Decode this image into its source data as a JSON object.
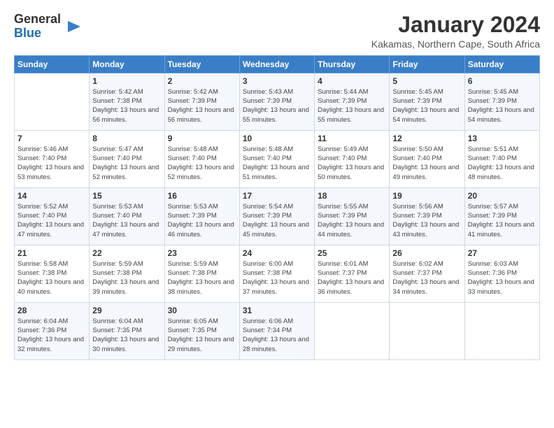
{
  "logo": {
    "text_general": "General",
    "text_blue": "Blue"
  },
  "title": "January 2024",
  "subtitle": "Kakamas, Northern Cape, South Africa",
  "headers": [
    "Sunday",
    "Monday",
    "Tuesday",
    "Wednesday",
    "Thursday",
    "Friday",
    "Saturday"
  ],
  "weeks": [
    [
      {
        "num": "",
        "sunrise": "",
        "sunset": "",
        "daylight": ""
      },
      {
        "num": "1",
        "sunrise": "Sunrise: 5:42 AM",
        "sunset": "Sunset: 7:38 PM",
        "daylight": "Daylight: 13 hours and 56 minutes."
      },
      {
        "num": "2",
        "sunrise": "Sunrise: 5:42 AM",
        "sunset": "Sunset: 7:39 PM",
        "daylight": "Daylight: 13 hours and 56 minutes."
      },
      {
        "num": "3",
        "sunrise": "Sunrise: 5:43 AM",
        "sunset": "Sunset: 7:39 PM",
        "daylight": "Daylight: 13 hours and 55 minutes."
      },
      {
        "num": "4",
        "sunrise": "Sunrise: 5:44 AM",
        "sunset": "Sunset: 7:39 PM",
        "daylight": "Daylight: 13 hours and 55 minutes."
      },
      {
        "num": "5",
        "sunrise": "Sunrise: 5:45 AM",
        "sunset": "Sunset: 7:39 PM",
        "daylight": "Daylight: 13 hours and 54 minutes."
      },
      {
        "num": "6",
        "sunrise": "Sunrise: 5:45 AM",
        "sunset": "Sunset: 7:39 PM",
        "daylight": "Daylight: 13 hours and 54 minutes."
      }
    ],
    [
      {
        "num": "7",
        "sunrise": "Sunrise: 5:46 AM",
        "sunset": "Sunset: 7:40 PM",
        "daylight": "Daylight: 13 hours and 53 minutes."
      },
      {
        "num": "8",
        "sunrise": "Sunrise: 5:47 AM",
        "sunset": "Sunset: 7:40 PM",
        "daylight": "Daylight: 13 hours and 52 minutes."
      },
      {
        "num": "9",
        "sunrise": "Sunrise: 5:48 AM",
        "sunset": "Sunset: 7:40 PM",
        "daylight": "Daylight: 13 hours and 52 minutes."
      },
      {
        "num": "10",
        "sunrise": "Sunrise: 5:48 AM",
        "sunset": "Sunset: 7:40 PM",
        "daylight": "Daylight: 13 hours and 51 minutes."
      },
      {
        "num": "11",
        "sunrise": "Sunrise: 5:49 AM",
        "sunset": "Sunset: 7:40 PM",
        "daylight": "Daylight: 13 hours and 50 minutes."
      },
      {
        "num": "12",
        "sunrise": "Sunrise: 5:50 AM",
        "sunset": "Sunset: 7:40 PM",
        "daylight": "Daylight: 13 hours and 49 minutes."
      },
      {
        "num": "13",
        "sunrise": "Sunrise: 5:51 AM",
        "sunset": "Sunset: 7:40 PM",
        "daylight": "Daylight: 13 hours and 48 minutes."
      }
    ],
    [
      {
        "num": "14",
        "sunrise": "Sunrise: 5:52 AM",
        "sunset": "Sunset: 7:40 PM",
        "daylight": "Daylight: 13 hours and 47 minutes."
      },
      {
        "num": "15",
        "sunrise": "Sunrise: 5:53 AM",
        "sunset": "Sunset: 7:40 PM",
        "daylight": "Daylight: 13 hours and 47 minutes."
      },
      {
        "num": "16",
        "sunrise": "Sunrise: 5:53 AM",
        "sunset": "Sunset: 7:39 PM",
        "daylight": "Daylight: 13 hours and 46 minutes."
      },
      {
        "num": "17",
        "sunrise": "Sunrise: 5:54 AM",
        "sunset": "Sunset: 7:39 PM",
        "daylight": "Daylight: 13 hours and 45 minutes."
      },
      {
        "num": "18",
        "sunrise": "Sunrise: 5:55 AM",
        "sunset": "Sunset: 7:39 PM",
        "daylight": "Daylight: 13 hours and 44 minutes."
      },
      {
        "num": "19",
        "sunrise": "Sunrise: 5:56 AM",
        "sunset": "Sunset: 7:39 PM",
        "daylight": "Daylight: 13 hours and 43 minutes."
      },
      {
        "num": "20",
        "sunrise": "Sunrise: 5:57 AM",
        "sunset": "Sunset: 7:39 PM",
        "daylight": "Daylight: 13 hours and 41 minutes."
      }
    ],
    [
      {
        "num": "21",
        "sunrise": "Sunrise: 5:58 AM",
        "sunset": "Sunset: 7:38 PM",
        "daylight": "Daylight: 13 hours and 40 minutes."
      },
      {
        "num": "22",
        "sunrise": "Sunrise: 5:59 AM",
        "sunset": "Sunset: 7:38 PM",
        "daylight": "Daylight: 13 hours and 39 minutes."
      },
      {
        "num": "23",
        "sunrise": "Sunrise: 5:59 AM",
        "sunset": "Sunset: 7:38 PM",
        "daylight": "Daylight: 13 hours and 38 minutes."
      },
      {
        "num": "24",
        "sunrise": "Sunrise: 6:00 AM",
        "sunset": "Sunset: 7:38 PM",
        "daylight": "Daylight: 13 hours and 37 minutes."
      },
      {
        "num": "25",
        "sunrise": "Sunrise: 6:01 AM",
        "sunset": "Sunset: 7:37 PM",
        "daylight": "Daylight: 13 hours and 36 minutes."
      },
      {
        "num": "26",
        "sunrise": "Sunrise: 6:02 AM",
        "sunset": "Sunset: 7:37 PM",
        "daylight": "Daylight: 13 hours and 34 minutes."
      },
      {
        "num": "27",
        "sunrise": "Sunrise: 6:03 AM",
        "sunset": "Sunset: 7:36 PM",
        "daylight": "Daylight: 13 hours and 33 minutes."
      }
    ],
    [
      {
        "num": "28",
        "sunrise": "Sunrise: 6:04 AM",
        "sunset": "Sunset: 7:36 PM",
        "daylight": "Daylight: 13 hours and 32 minutes."
      },
      {
        "num": "29",
        "sunrise": "Sunrise: 6:04 AM",
        "sunset": "Sunset: 7:35 PM",
        "daylight": "Daylight: 13 hours and 30 minutes."
      },
      {
        "num": "30",
        "sunrise": "Sunrise: 6:05 AM",
        "sunset": "Sunset: 7:35 PM",
        "daylight": "Daylight: 13 hours and 29 minutes."
      },
      {
        "num": "31",
        "sunrise": "Sunrise: 6:06 AM",
        "sunset": "Sunset: 7:34 PM",
        "daylight": "Daylight: 13 hours and 28 minutes."
      },
      {
        "num": "",
        "sunrise": "",
        "sunset": "",
        "daylight": ""
      },
      {
        "num": "",
        "sunrise": "",
        "sunset": "",
        "daylight": ""
      },
      {
        "num": "",
        "sunrise": "",
        "sunset": "",
        "daylight": ""
      }
    ]
  ]
}
